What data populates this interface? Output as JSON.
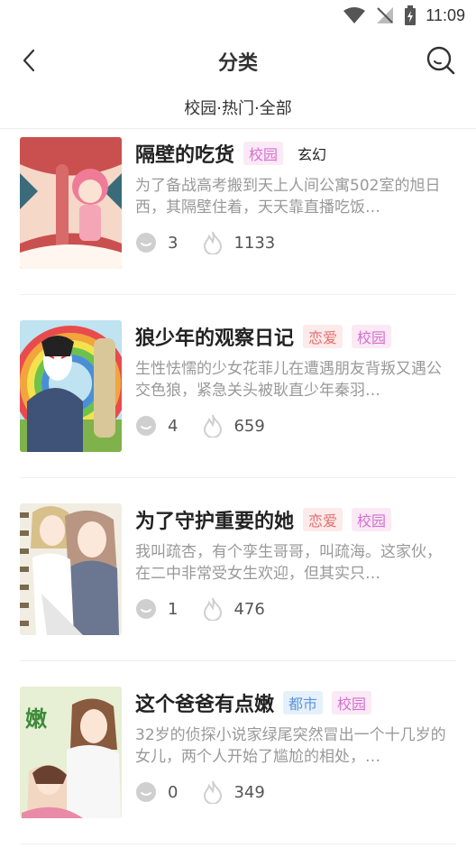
{
  "status": {
    "time": "11:09",
    "wifi_icon": "wifi-icon",
    "signal_icon": "no-signal-icon",
    "battery_icon": "battery-charging-icon"
  },
  "header": {
    "title": "分类",
    "back_icon": "chevron-left-icon",
    "search_icon": "search-icon"
  },
  "subtitle": "校园·热门·全部",
  "items": [
    {
      "title": "隔壁的吃货",
      "tags": [
        "校园",
        "玄幻"
      ],
      "desc": "为了备战高考搬到天上人间公寓502室的旭日西，其隔壁住着，天天靠直播吃饭…",
      "comments": "3",
      "heat": "1133"
    },
    {
      "title": "狼少年的观察日记",
      "tags": [
        "恋爱",
        "校园"
      ],
      "desc": "生性怯懦的少女花菲儿在遭遇朋友背叛又遇公交色狼，紧急关头被耿直少年秦羽…",
      "comments": "4",
      "heat": "659"
    },
    {
      "title": "为了守护重要的她",
      "tags": [
        "恋爱",
        "校园"
      ],
      "desc": "我叫疏杏，有个孪生哥哥，叫疏海。这家伙，在二中非常受女生欢迎，但其实只…",
      "comments": "1",
      "heat": "476"
    },
    {
      "title": "这个爸爸有点嫩",
      "tags": [
        "都市",
        "校园"
      ],
      "desc": "32岁的侦探小说家绿尾突然冒出一个十几岁的女儿，两个人开始了尴尬的相处，…",
      "comments": "0",
      "heat": "349"
    }
  ],
  "covers": [
    {
      "text": ""
    },
    {
      "text": ""
    },
    {
      "text": ""
    },
    {
      "text": "这个爸爸有点嫩"
    }
  ],
  "colors": {
    "tag_pink": "#d56fcf",
    "tag_red": "#e07070",
    "tag_blue": "#5c95d8",
    "desc": "#999999"
  }
}
